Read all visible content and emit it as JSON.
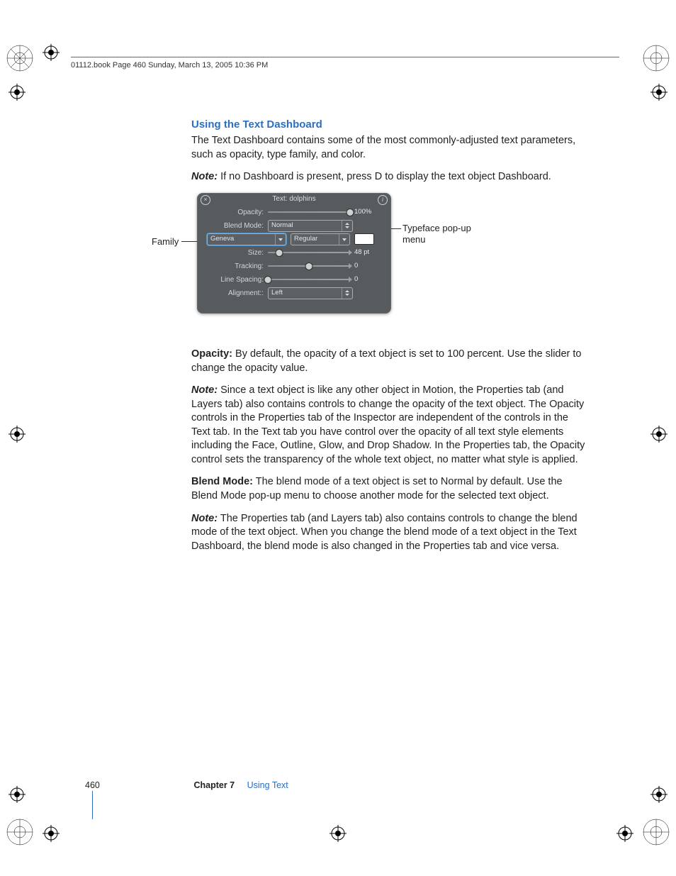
{
  "header_line": "01112.book  Page 460  Sunday, March 13, 2005  10:36 PM",
  "heading": "Using the Text Dashboard",
  "intro": "The Text Dashboard contains some of the most commonly-adjusted text parameters, such as opacity, type family, and color.",
  "note1_label": "Note:",
  "note1_a": "If no Dashboard is present, press ",
  "note1_key": "D",
  "note1_b": " to display the text object Dashboard.",
  "callout_family": "Family",
  "callout_typeface": "Typeface pop-up menu",
  "dashboard": {
    "title": "Text: dolphins",
    "labels": {
      "opacity": "Opacity:",
      "blend": "Blend Mode:",
      "size": "Size:",
      "tracking": "Tracking:",
      "linespacing": "Line Spacing:",
      "alignment": "Alignment::"
    },
    "values": {
      "opacity": "100%",
      "blend": "Normal",
      "family": "Geneva",
      "typeface": "Regular",
      "size": "48 pt",
      "tracking": "0",
      "linespacing": "0",
      "alignment": "Left"
    }
  },
  "p_opacity_label": "Opacity:",
  "p_opacity": "By default, the opacity of a text object is set to 100 percent. Use the slider to change the opacity value.",
  "note2_label": "Note:",
  "note2": "Since a text object is like any other object in Motion, the Properties tab (and Layers tab) also contains controls to change the opacity of the text object. The Opacity controls in the Properties tab of the Inspector are independent of the controls in the Text tab. In the Text tab you have control over the opacity of all text style elements including the Face, Outline, Glow, and Drop Shadow. In the Properties tab, the Opacity control sets the transparency of the whole text object, no matter what style is applied.",
  "p_blend_label": "Blend Mode:",
  "p_blend": "The blend mode of a text object is set to Normal by default. Use the Blend Mode pop-up menu to choose another mode for the selected text object.",
  "note3_label": "Note:",
  "note3": "The Properties tab (and Layers tab) also contains controls to change the blend mode of the text object. When you change the blend mode of a text object in the Text Dashboard, the blend mode is also changed in the Properties tab and vice versa.",
  "footer": {
    "page": "460",
    "chapter": "Chapter 7",
    "section": "Using Text"
  }
}
